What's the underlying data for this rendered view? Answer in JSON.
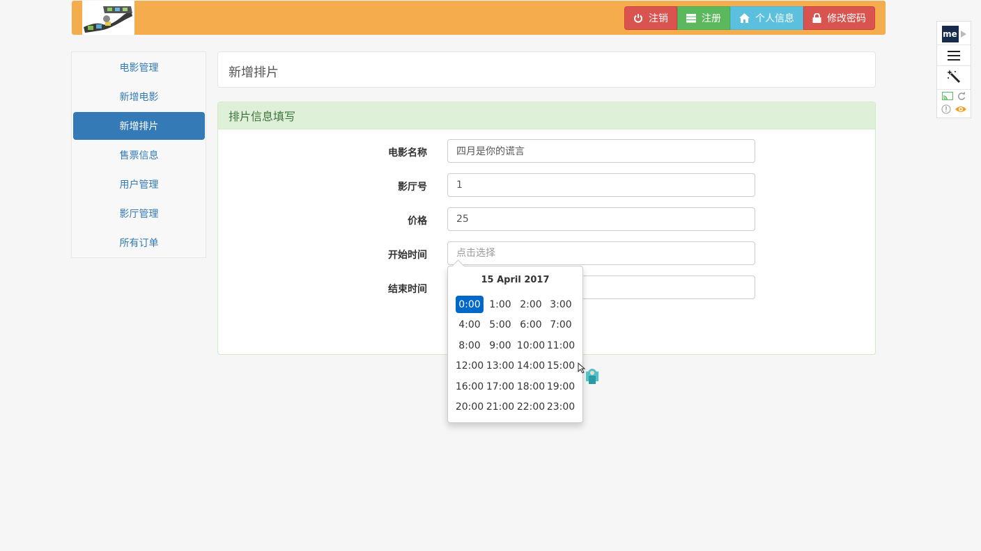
{
  "navbar": {
    "buttons": [
      {
        "label": "注销",
        "icon": "power-icon",
        "color": "#d9534f"
      },
      {
        "label": "注册",
        "icon": "server-icon",
        "color": "#5cb85c"
      },
      {
        "label": "个人信息",
        "icon": "home-icon",
        "color": "#5bc0de"
      },
      {
        "label": "修改密码",
        "icon": "lock-icon",
        "color": "#d9534f"
      }
    ],
    "background": "#f4ac4c"
  },
  "sidebar": {
    "items": [
      {
        "label": "电影管理"
      },
      {
        "label": "新增电影"
      },
      {
        "label": "新增排片",
        "active": true
      },
      {
        "label": "售票信息"
      },
      {
        "label": "用户管理"
      },
      {
        "label": "影厅管理"
      },
      {
        "label": "所有订单"
      }
    ],
    "active_color": "#337ab7"
  },
  "page_title": "新增排片",
  "form": {
    "heading": "排片信息填写",
    "fields": [
      {
        "label": "电影名称",
        "value": "四月是你的谎言",
        "placeholder": ""
      },
      {
        "label": "影厅号",
        "value": "1",
        "placeholder": ""
      },
      {
        "label": "价格",
        "value": "25",
        "placeholder": ""
      },
      {
        "label": "开始时间",
        "value": "",
        "placeholder": "点击选择"
      },
      {
        "label": "结束时间",
        "value": "",
        "placeholder": ""
      }
    ]
  },
  "datepicker": {
    "title": "15 April 2017",
    "hours": [
      "0:00",
      "1:00",
      "2:00",
      "3:00",
      "4:00",
      "5:00",
      "6:00",
      "7:00",
      "8:00",
      "9:00",
      "10:00",
      "11:00",
      "12:00",
      "13:00",
      "14:00",
      "15:00",
      "16:00",
      "17:00",
      "18:00",
      "19:00",
      "20:00",
      "21:00",
      "22:00",
      "23:00"
    ],
    "selected": "0:00",
    "selected_color": "#0068c9"
  },
  "extension_toolbar": {
    "badge": "me",
    "icons": [
      "menu-icon",
      "magic-wand-icon",
      "cast-icon",
      "refresh-icon",
      "info-icon",
      "eye-icon"
    ]
  }
}
